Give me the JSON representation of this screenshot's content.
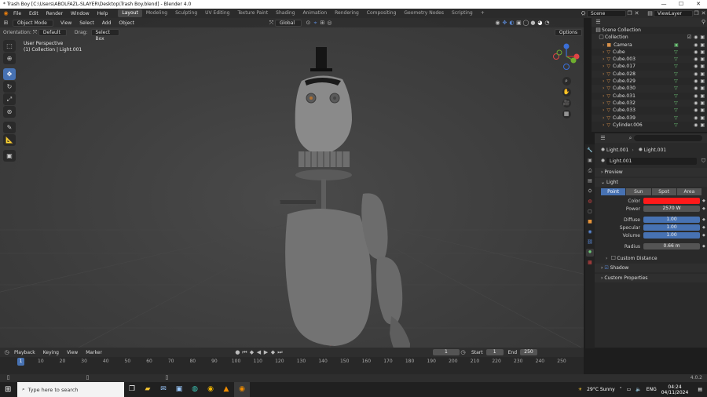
{
  "window": {
    "title": "* Trash Boy [C:\\Users\\ABOLFAZL-SLAYER\\Desktop\\Trash Boy.blend] - Blender 4.0"
  },
  "menu": [
    "File",
    "Edit",
    "Render",
    "Window",
    "Help"
  ],
  "workspaces": [
    "Layout",
    "Modeling",
    "Sculpting",
    "UV Editing",
    "Texture Paint",
    "Shading",
    "Animation",
    "Rendering",
    "Compositing",
    "Geometry Nodes",
    "Scripting"
  ],
  "scene": "Scene",
  "view_layer": "ViewLayer",
  "viewport": {
    "mode": "Object Mode",
    "menus": [
      "View",
      "Select",
      "Add",
      "Object"
    ],
    "transform": "Global",
    "orientation_label": "Orientation:",
    "orientation_value": "Default",
    "drag_label": "Drag:",
    "drag_value": "Select Box",
    "options": "Options",
    "overlay_line1": "User Perspective",
    "overlay_line2": "(1) Collection | Light.001"
  },
  "outliner": {
    "root": "Scene Collection",
    "collection": "Collection",
    "items": [
      "Camera",
      "Cube",
      "Cube.003",
      "Cube.017",
      "Cube.028",
      "Cube.029",
      "Cube.030",
      "Cube.031",
      "Cube.032",
      "Cube.033",
      "Cube.039",
      "Cylinder.006"
    ]
  },
  "properties": {
    "breadcrumb_object": "Light.001",
    "breadcrumb_data": "Light.001",
    "datablock": "Light.001",
    "preview": "Preview",
    "light_panel": "Light",
    "light_types": [
      "Point",
      "Sun",
      "Spot",
      "Area"
    ],
    "color_label": "Color",
    "color_value": "#ff1a1a",
    "power_label": "Power",
    "power_value": "2570 W",
    "diffuse_label": "Diffuse",
    "diffuse_value": "1.00",
    "specular_label": "Specular",
    "specular_value": "1.00",
    "volume_label": "Volume",
    "volume_value": "1.00",
    "radius_label": "Radius",
    "radius_value": "0.66 m",
    "custom_distance": "Custom Distance",
    "shadow": "Shadow",
    "custom_properties": "Custom Properties"
  },
  "timeline": {
    "menus": [
      "Playback",
      "Keying",
      "View",
      "Marker"
    ],
    "current_frame": "1",
    "start_label": "Start",
    "start_value": "1",
    "end_label": "End",
    "end_value": "250",
    "ticks": [
      "1",
      "10",
      "20",
      "30",
      "40",
      "50",
      "60",
      "70",
      "80",
      "90",
      "100",
      "110",
      "120",
      "130",
      "140",
      "150",
      "160",
      "170",
      "180",
      "190",
      "200",
      "210",
      "220",
      "230",
      "240",
      "250"
    ]
  },
  "version": "4.0.2",
  "taskbar": {
    "search_placeholder": "Type here to search",
    "weather": "29°C Sunny",
    "lang": "ENG",
    "time": "04:24",
    "date": "04/11/2024"
  }
}
